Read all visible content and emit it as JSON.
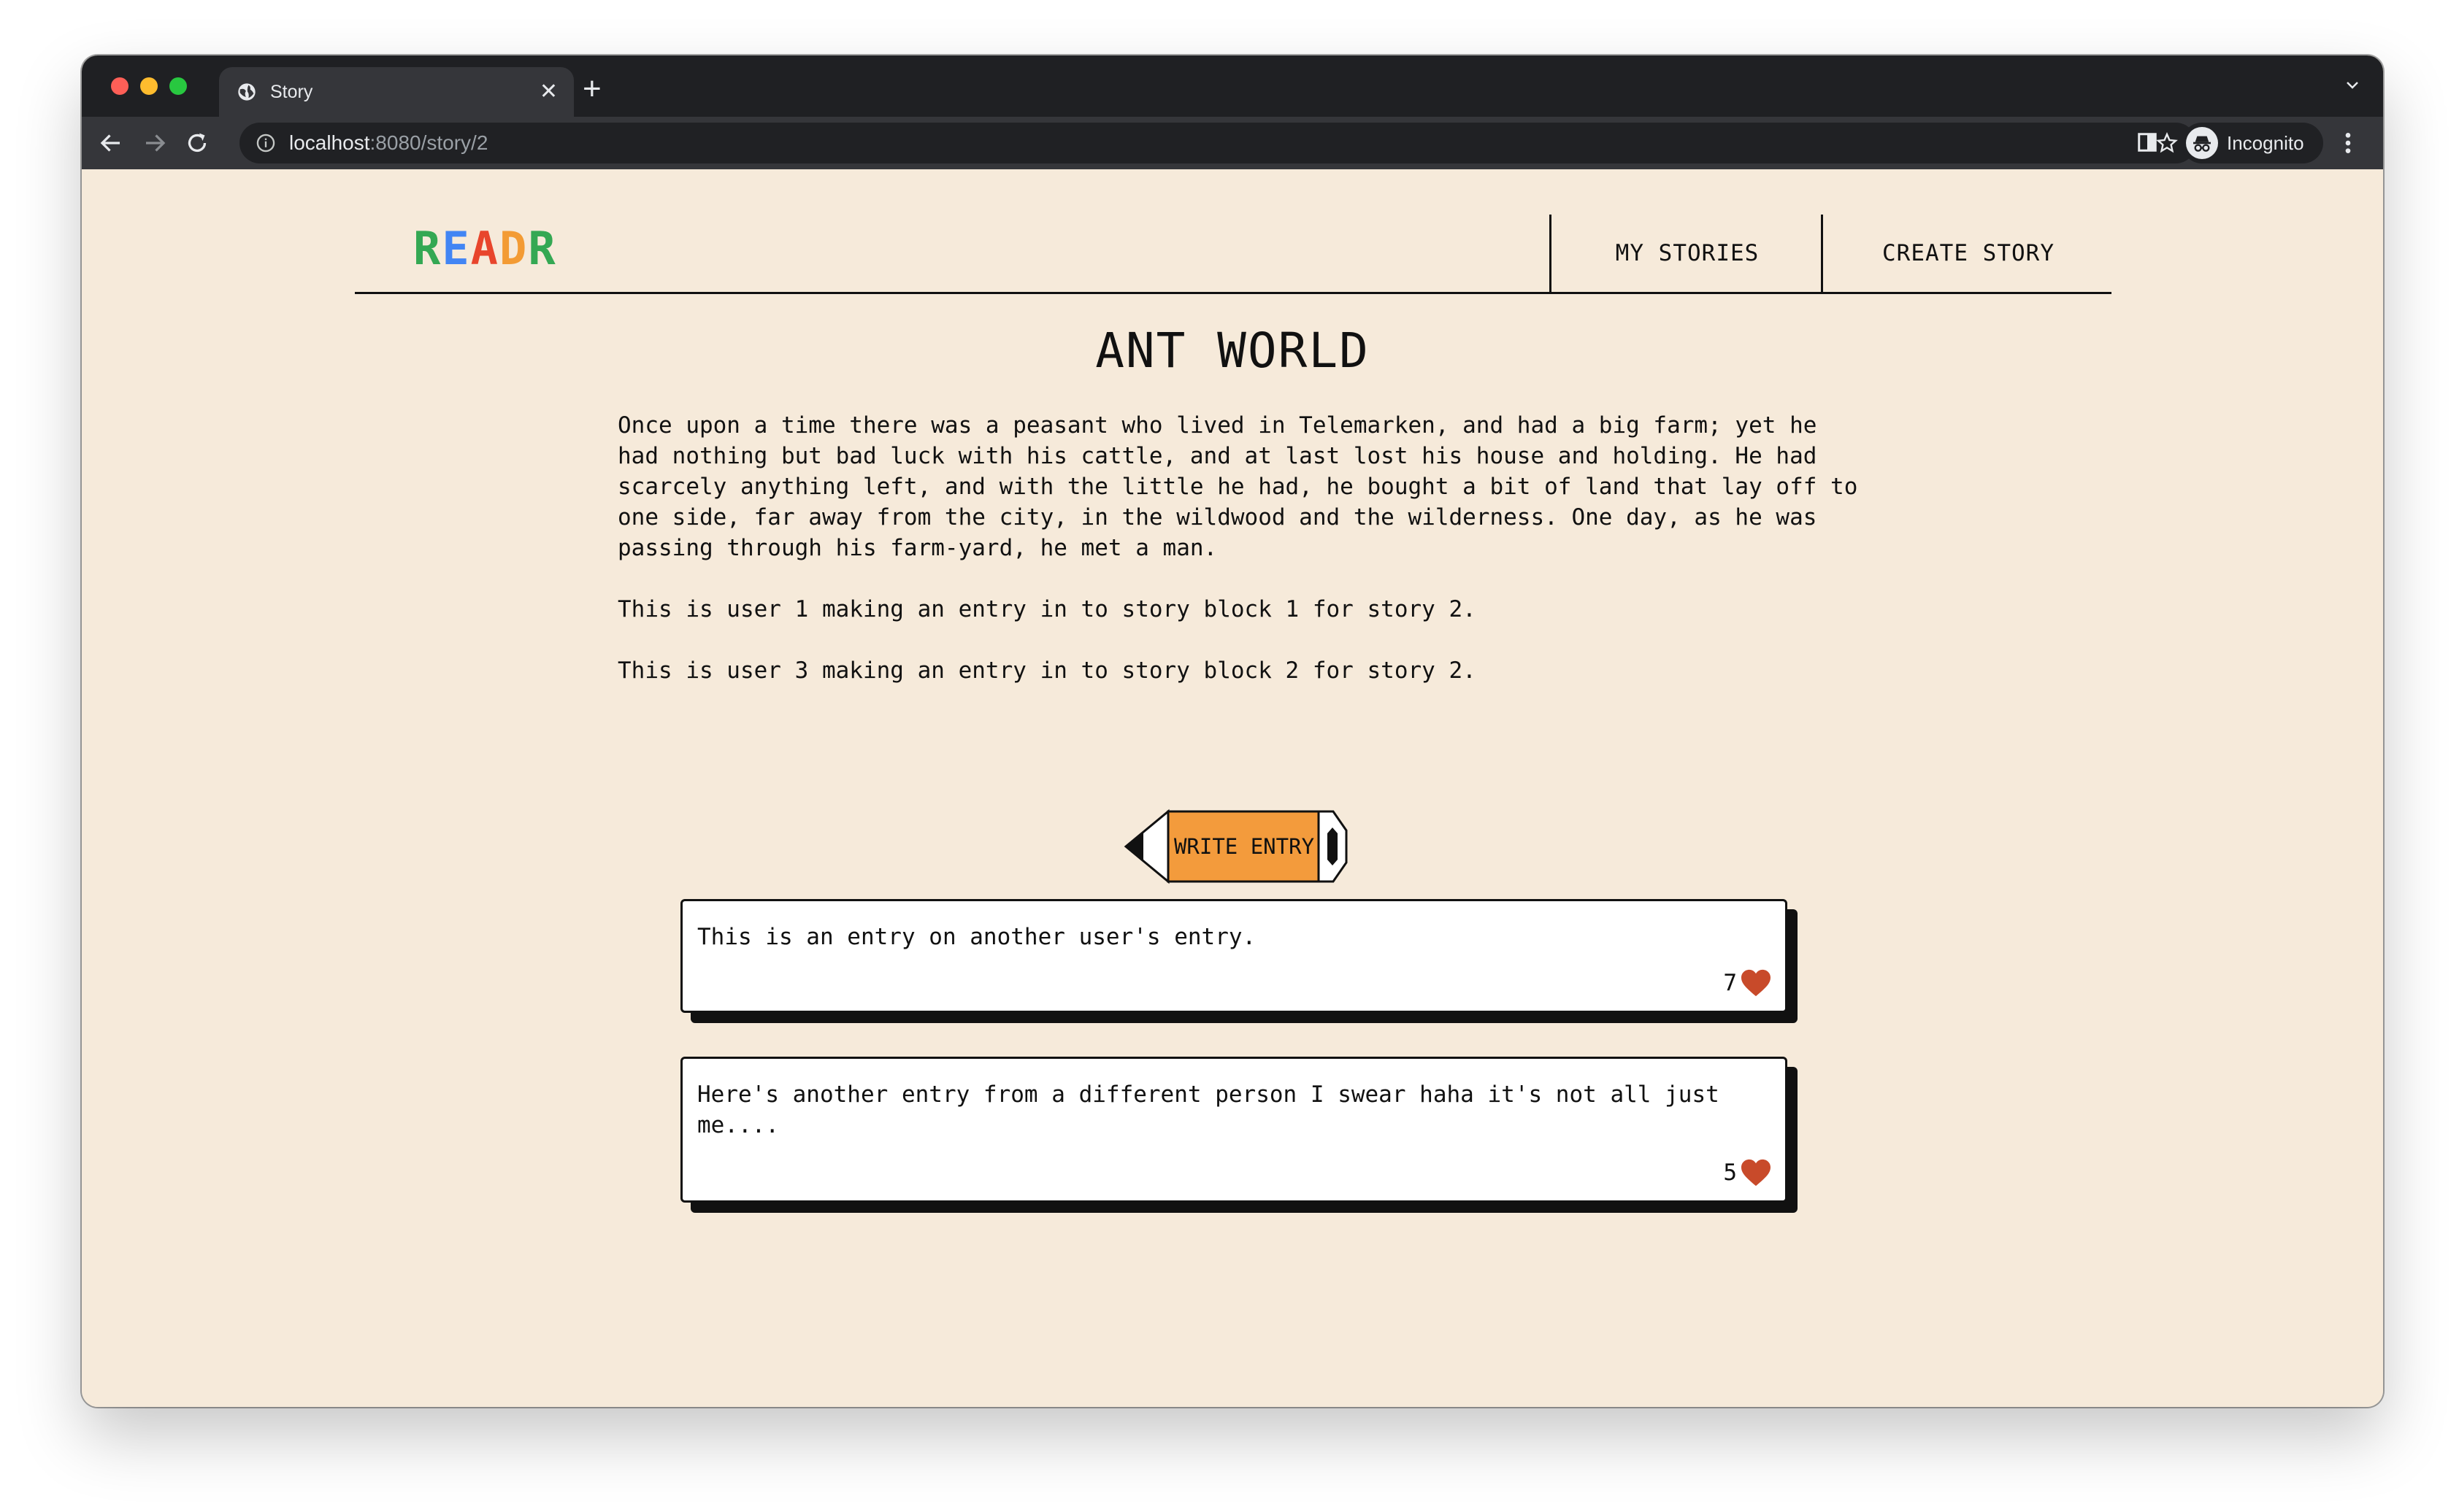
{
  "browser": {
    "tab_title": "Story",
    "new_tab_label": "+",
    "url_host": "localhost",
    "url_path": ":8080/story/2",
    "profile_label": "Incognito"
  },
  "header": {
    "logo_letters": [
      "R",
      "E",
      "A",
      "D",
      "R"
    ],
    "logo_colors": [
      "#34a853",
      "#4285f4",
      "#e8452c",
      "#f39b34",
      "#34a853"
    ],
    "nav": {
      "my_stories": "MY STORIES",
      "create_story": "CREATE STORY"
    }
  },
  "story": {
    "title": "ANT WORLD",
    "blocks": [
      "Once upon a time there was a peasant who lived in Telemarken, and had a big farm; yet he had nothing but bad luck with his cattle, and at last lost his house and holding. He had scarcely anything left, and with the little he had, he bought a bit of land that lay off to one side, far away from the city, in the wildwood and the wilderness. One day, as he was passing through his farm-yard, he met a man.",
      "This is user 1 making an entry in to story block 1 for story 2.",
      "This is user 3 making an entry in to story block 2 for story 2."
    ]
  },
  "write_entry": {
    "label": "WRITE ENTRY",
    "color": "#f39b3c"
  },
  "entries": [
    {
      "text": "This is an entry on another user's entry.",
      "likes": "7"
    },
    {
      "text": "Here's another entry from a different person I swear haha it's not all just me....",
      "likes": "5"
    }
  ],
  "colors": {
    "page_bg": "#f6eada",
    "heart": "#c84a2a"
  }
}
